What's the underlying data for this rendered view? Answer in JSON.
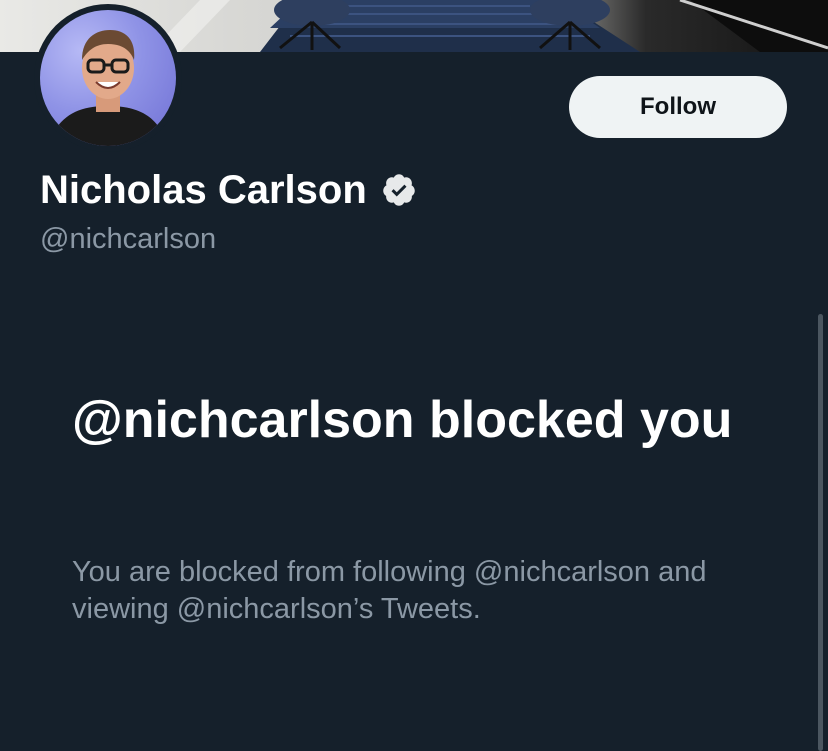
{
  "profile": {
    "display_name": "Nicholas Carlson",
    "handle": "@nichcarlson",
    "verified": true,
    "verified_icon": "verified-badge-icon"
  },
  "actions": {
    "follow_label": "Follow"
  },
  "blocked_notice": {
    "title": "@nichcarlson blocked you",
    "description": "You are blocked from following @nichcarlson and viewing @nichcarlson’s Tweets."
  },
  "colors": {
    "background": "#15202b",
    "primary_text": "#ffffff",
    "secondary_text": "#8b98a5",
    "button_bg": "#eff3f4",
    "button_text": "#0f1419"
  }
}
